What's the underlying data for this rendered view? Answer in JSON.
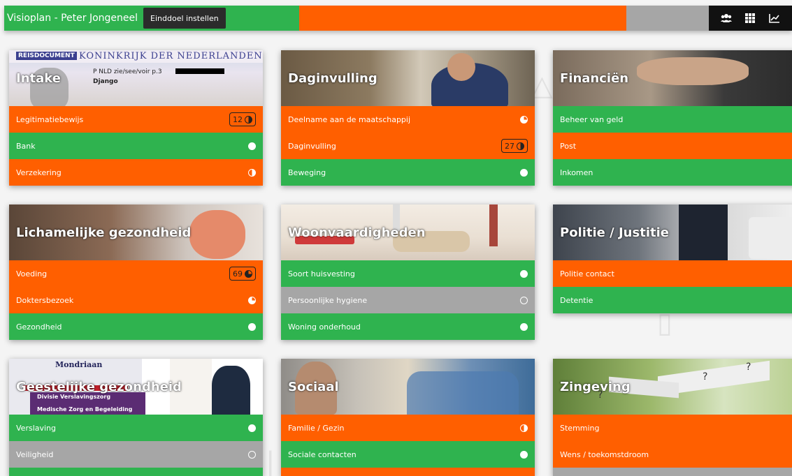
{
  "topbar": {
    "title": "Visioplan - Peter Jongeneel",
    "goal_button": "Einddoel instellen",
    "status_colors": [
      "#2fb34f",
      "#ff5f00",
      "#a6a6a6"
    ],
    "icons": [
      "users-icon",
      "grid-icon",
      "chart-line-icon"
    ]
  },
  "colors": {
    "green": "#2fb34f",
    "orange": "#ff5f00",
    "grey": "#a6a6a6"
  },
  "cards": [
    {
      "title": "Intake",
      "image_text": {
        "header": "REISDOCUMENT",
        "country": "KONINKRIJK DER NEDERLANDEN",
        "line1": "P NLD zie/see/voir p.3",
        "name": "Django"
      },
      "rows": [
        {
          "label": "Legitimatiebewijs",
          "status": "orange",
          "badge": "12",
          "progress": "half"
        },
        {
          "label": "Bank",
          "status": "green",
          "progress": "full"
        },
        {
          "label": "Verzekering",
          "status": "orange",
          "progress": "half"
        }
      ]
    },
    {
      "title": "Daginvulling",
      "rows": [
        {
          "label": "Deelname aan de maatschappij",
          "status": "orange",
          "progress": "three-quarter"
        },
        {
          "label": "Daginvulling",
          "status": "orange",
          "badge": "27",
          "progress": "half"
        },
        {
          "label": "Beweging",
          "status": "green",
          "progress": "full"
        }
      ]
    },
    {
      "title": "Financiën",
      "rows": [
        {
          "label": "Beheer van geld",
          "status": "green"
        },
        {
          "label": "Post",
          "status": "orange"
        },
        {
          "label": "Inkomen",
          "status": "green"
        }
      ]
    },
    {
      "title": "Lichamelijke gezondheid",
      "rows": [
        {
          "label": "Voeding",
          "status": "orange",
          "badge": "69",
          "progress": "three-quarter"
        },
        {
          "label": "Doktersbezoek",
          "status": "orange",
          "progress": "quarter"
        },
        {
          "label": "Gezondheid",
          "status": "green",
          "progress": "full"
        }
      ]
    },
    {
      "title": "Woonvaardigheden",
      "rows": [
        {
          "label": "Soort huisvesting",
          "status": "green",
          "progress": "full"
        },
        {
          "label": "Persoonlijke hygiene",
          "status": "grey",
          "progress": "empty"
        },
        {
          "label": "Woning onderhoud",
          "status": "green",
          "progress": "full"
        }
      ]
    },
    {
      "title": "Politie / Justitie",
      "rows": [
        {
          "label": "Politie contact",
          "status": "orange"
        },
        {
          "label": "Detentie",
          "status": "green"
        }
      ]
    },
    {
      "title": "Geestelijke gezondheid",
      "image_text": {
        "org": "Mondriaan",
        "line1": "Divisie Verslavingszorg",
        "line2": "Medische Zorg en Begeleiding"
      },
      "rows": [
        {
          "label": "Verslaving",
          "status": "green",
          "progress": "full"
        },
        {
          "label": "Veiligheid",
          "status": "grey",
          "progress": "empty"
        }
      ]
    },
    {
      "title": "Sociaal",
      "rows": [
        {
          "label": "Familie / Gezin",
          "status": "orange",
          "progress": "half"
        },
        {
          "label": "Sociale contacten",
          "status": "green",
          "progress": "full"
        }
      ]
    },
    {
      "title": "Zingeving",
      "rows": [
        {
          "label": "Stemming",
          "status": "orange"
        },
        {
          "label": "Wens / toekomstdroom",
          "status": "orange"
        }
      ]
    }
  ]
}
